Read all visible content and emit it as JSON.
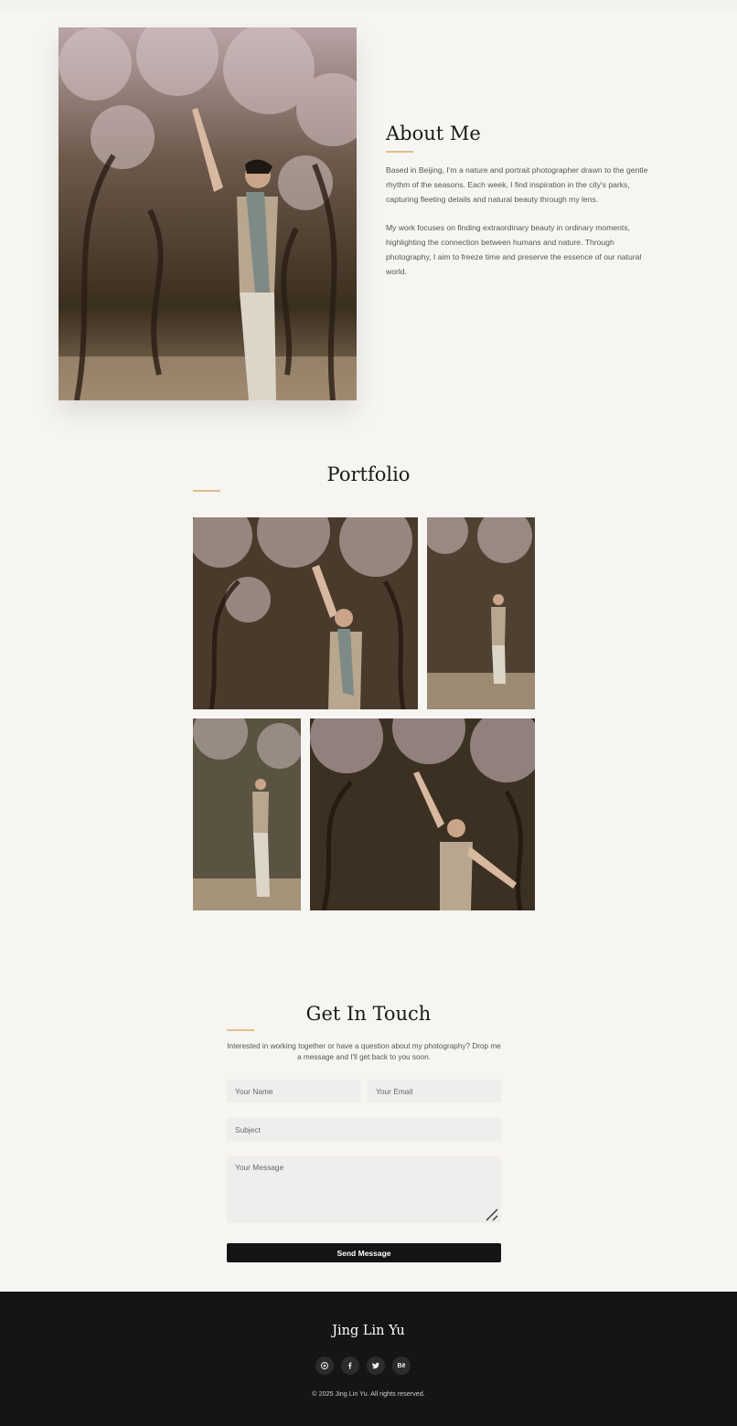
{
  "about": {
    "title": "About Me",
    "paragraphs": [
      "Based in Beijing, I'm a nature and portrait photographer drawn to the gentle rhythm of the seasons. Each week, I find inspiration in the city's parks, capturing fleeting details and natural beauty through my lens.",
      "My work focuses on finding extraordinary beauty in ordinary moments, highlighting the connection between humans and nature. Through photography, I aim to freeze time and preserve the essence of our natural world."
    ]
  },
  "portfolio": {
    "title": "Portfolio"
  },
  "contact": {
    "title": "Get In Touch",
    "intro": "Interested in working together or have a question about my photography? Drop me a message and I'll get back to you soon.",
    "name_placeholder": "Your Name",
    "email_placeholder": "Your Email",
    "subject_placeholder": "Subject",
    "message_placeholder": "Your Message",
    "send_label": "Send Message"
  },
  "footer": {
    "name": "Jing Lin Yu",
    "socials": [
      "instagram-icon",
      "facebook-icon",
      "twitter-icon",
      "behance-icon"
    ],
    "behance_glyph": "Bē",
    "copyright": "© 2025 Jing Lin Yu. All rights reserved."
  },
  "colors": {
    "background": "#f7f5f2",
    "accent_gold": "#e0be86",
    "footer_bg": "#151515",
    "button_bg": "#141414",
    "input_bg": "#efeeec"
  }
}
